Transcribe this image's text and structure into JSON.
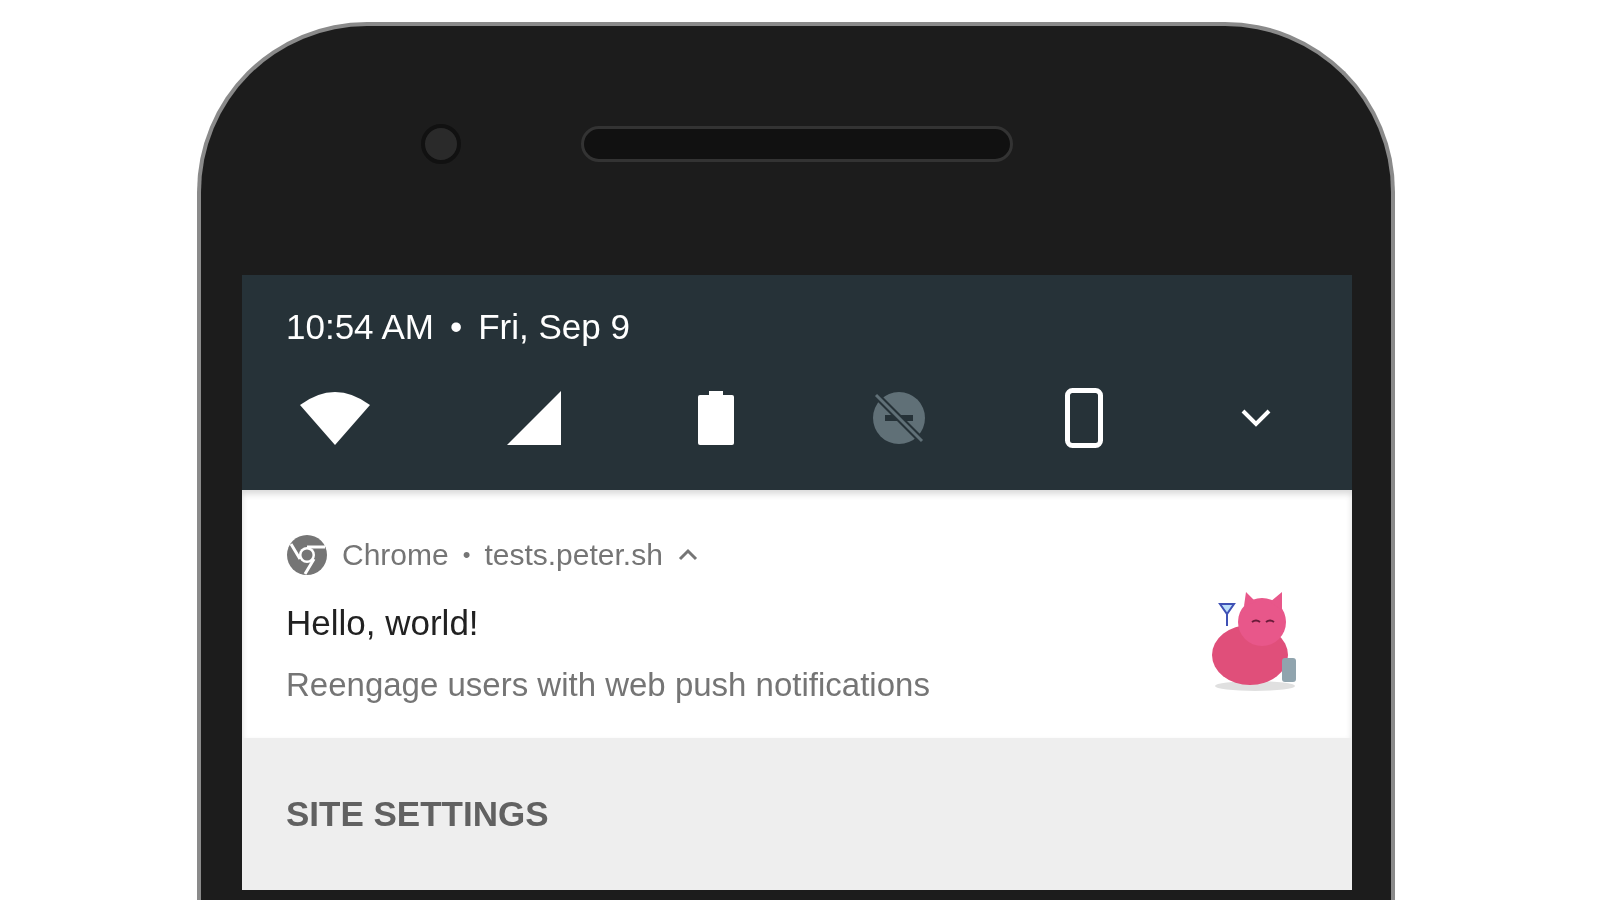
{
  "status": {
    "time": "10:54 AM",
    "separator": "•",
    "date": "Fri, Sep 9"
  },
  "quick_settings": [
    {
      "kind": "wifi",
      "on": true
    },
    {
      "kind": "signal",
      "on": true
    },
    {
      "kind": "battery",
      "on": true
    },
    {
      "kind": "dnd",
      "on": false
    },
    {
      "kind": "rotate",
      "on": true
    },
    {
      "kind": "expand",
      "on": true
    }
  ],
  "notification": {
    "app": "Chrome",
    "separator": "•",
    "site": "tests.peter.sh",
    "expanded": true,
    "title": "Hello, world!",
    "body": "Reengage users with web push notifications",
    "action": "SITE SETTINGS"
  }
}
